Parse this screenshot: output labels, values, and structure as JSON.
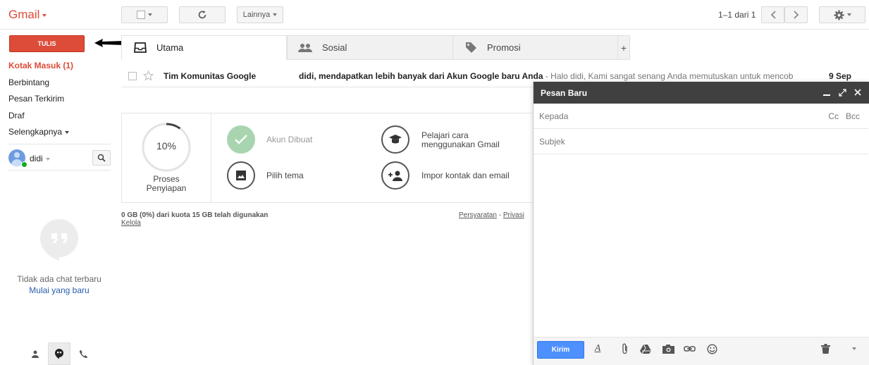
{
  "header": {
    "logo": "Gmail",
    "refresh_icon": "refresh-icon",
    "more_label": "Lainnya",
    "page_count": "1–1 dari 1",
    "settings_icon": "gear-icon"
  },
  "sidebar": {
    "compose_label": "TULIS",
    "items": [
      {
        "label": "Kotak Masuk (1)"
      },
      {
        "label": "Berbintang"
      },
      {
        "label": "Pesan Terkirim"
      },
      {
        "label": "Draf"
      },
      {
        "label": "Selengkapnya"
      }
    ],
    "user_name": "didi",
    "chat_empty": "Tidak ada chat terbaru",
    "chat_start": "Mulai yang baru"
  },
  "tabs": [
    {
      "label": "Utama"
    },
    {
      "label": "Sosial"
    },
    {
      "label": "Promosi"
    }
  ],
  "tab_add": "+",
  "email": {
    "sender": "Tim Komunitas Google",
    "subject": "didi, mendapatkan lebih banyak dari Akun Google baru Anda",
    "snippet": " - Halo didi, Kami sangat senang Anda memutuskan untuk mencob",
    "date": "9 Sep"
  },
  "setup": {
    "progress_value": "10%",
    "progress_fraction": 0.1,
    "progress_label_1": "Proses",
    "progress_label_2": "Penyiapan",
    "task_account": "Akun Dibuat",
    "task_learn_1": "Pelajari cara",
    "task_learn_2": "menggunakan Gmail",
    "task_theme": "Pilih tema",
    "task_import": "Impor kontak dan email"
  },
  "footer": {
    "quota": "0 GB (0%) dari kuota 15 GB telah digunakan",
    "manage": "Kelola",
    "terms": "Persyaratan",
    "sep": "-",
    "privacy": "Privasi"
  },
  "compose": {
    "title": "Pesan Baru",
    "to_placeholder": "Kepada",
    "cc": "Cc",
    "bcc": "Bcc",
    "subject_placeholder": "Subjek",
    "send_label": "Kirim"
  },
  "colors": {
    "brand_red": "#dd4b39",
    "compose_header": "#404040",
    "send_blue": "#4d90fe",
    "check_green": "#a8d5b0"
  }
}
